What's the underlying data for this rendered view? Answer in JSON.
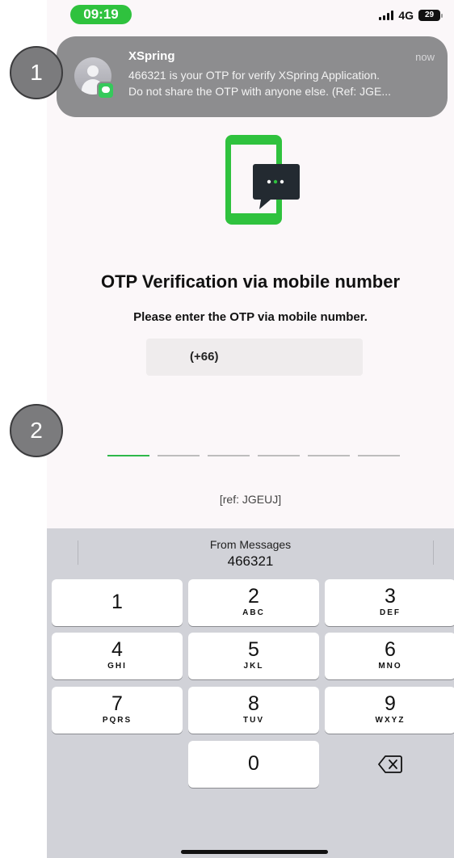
{
  "status_bar": {
    "time": "09:19",
    "network": "4G",
    "battery": "29"
  },
  "notification": {
    "app": "XSpring",
    "time": "now",
    "line1": "466321 is your OTP for verify XSpring Application.",
    "line2": "Do not share the OTP with anyone else. (Ref: JGE..."
  },
  "steps": [
    "1",
    "2"
  ],
  "page": {
    "title": "OTP Verification via mobile number",
    "subtitle": "Please enter the OTP via mobile number.",
    "phone_prefix": "(+66)",
    "ref": "[ref: JGEUJ]"
  },
  "keyboard": {
    "suggestion_label": "From Messages",
    "suggestion_code": "466321",
    "keys": [
      {
        "num": "1",
        "letters": ""
      },
      {
        "num": "2",
        "letters": "ABC"
      },
      {
        "num": "3",
        "letters": "DEF"
      },
      {
        "num": "4",
        "letters": "GHI"
      },
      {
        "num": "5",
        "letters": "JKL"
      },
      {
        "num": "6",
        "letters": "MNO"
      },
      {
        "num": "7",
        "letters": "PQRS"
      },
      {
        "num": "8",
        "letters": "TUV"
      },
      {
        "num": "9",
        "letters": "WXYZ"
      },
      {
        "num": "0",
        "letters": ""
      }
    ]
  },
  "colors": {
    "accent": "#2fc23e",
    "notification_bg": "#8d8d8f",
    "keyboard_bg": "#d1d2d8"
  }
}
